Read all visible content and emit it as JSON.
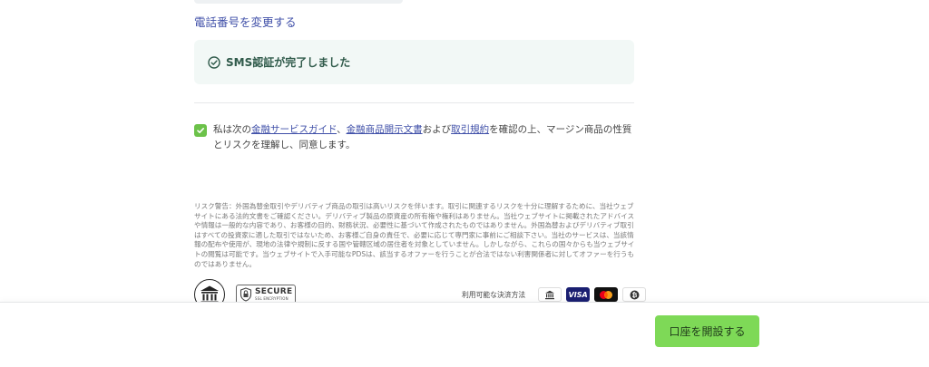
{
  "phone": {
    "change_link": "電話番号を変更する"
  },
  "sms_status": {
    "text": "SMS認証が完了しました",
    "icon": "check-circle-icon",
    "color": "#2f5a4a"
  },
  "consent": {
    "checked": true,
    "text_prefix": "私は次の",
    "link_guide": "金融サービスガイド",
    "sep1": "、",
    "link_disclosure": "金融商品開示文書",
    "and": "および",
    "link_terms": "取引規約",
    "text_suffix": "を確認の上、マージン商品の性質とリスクを理解し、同意します。"
  },
  "risk_warning": "リスク警告：外国為替金取引やデリバティブ商品の取引は高いリスクを伴います。取引に関連するリスクを十分に理解するために、当社ウェブサイトにある法的文書をご確認ください。デリバティブ製品の原資産の所有権や権利はありません。当社ウェブサイトに掲載されたアドバイスや情報は一般的な内容であり、お客様の目的、財務状況、必要性に基づいて作成されたものではありません。外国為替およびデリバティブ取引はすべての投資家に適した取引ではないため、お客様ご自身の責任で、必要に応じて専門家に事前にご相談下さい。当社のサービスは、当該情報の配布や使用が、現地の法律や規制に反する国や管轄区域の居住者を対象としていません。しかしながら、これらの国々からも当ウェブサイトの閲覧は可能です。当ウェブサイトで入手可能なPDSは、該当するオファーを行うことが合法ではない利害関係者に対してオファーを行うものではありません。",
  "badges": {
    "secure_main": "SECURE",
    "secure_sub": "SSL ENCRYPTION"
  },
  "payments": {
    "label": "利用可能な決済方法",
    "visa": "VISA",
    "icons": [
      "bank-icon",
      "visa-icon",
      "mastercard-icon",
      "bitcoin-icon"
    ]
  },
  "footer": {
    "open_account": "口座を開設する",
    "button_color": "#7ed957"
  }
}
